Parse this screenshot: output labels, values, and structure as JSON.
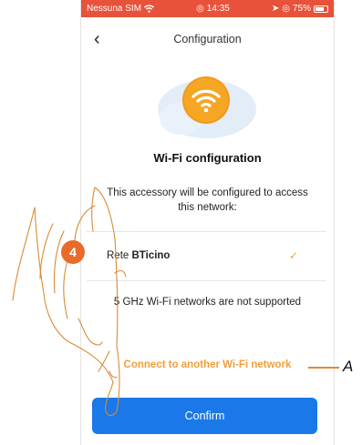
{
  "status_bar": {
    "carrier": "Nessuna SIM",
    "time": "14:35",
    "battery": "75%"
  },
  "nav": {
    "title": "Configuration",
    "back_icon": "chevron-left-icon"
  },
  "illustration": {
    "icon": "wifi-icon",
    "accent_color": "#f29a1d"
  },
  "content": {
    "heading": "Wi-Fi configuration",
    "description": "This accessory will be configured to access this network:",
    "network": {
      "prefix": "Rete",
      "name": "BTicino",
      "selected_icon": "checkmark-icon"
    },
    "note": "5 GHz Wi-Fi networks are not supported",
    "link": "Connect to another Wi-Fi network"
  },
  "actions": {
    "confirm": "Confirm"
  },
  "annotations": {
    "step_number": "4",
    "callout_letter": "A"
  },
  "colors": {
    "status_bar": "#e8523a",
    "link": "#f29e3a",
    "primary_button": "#1a78e8",
    "step_badge": "#e76c2a"
  }
}
